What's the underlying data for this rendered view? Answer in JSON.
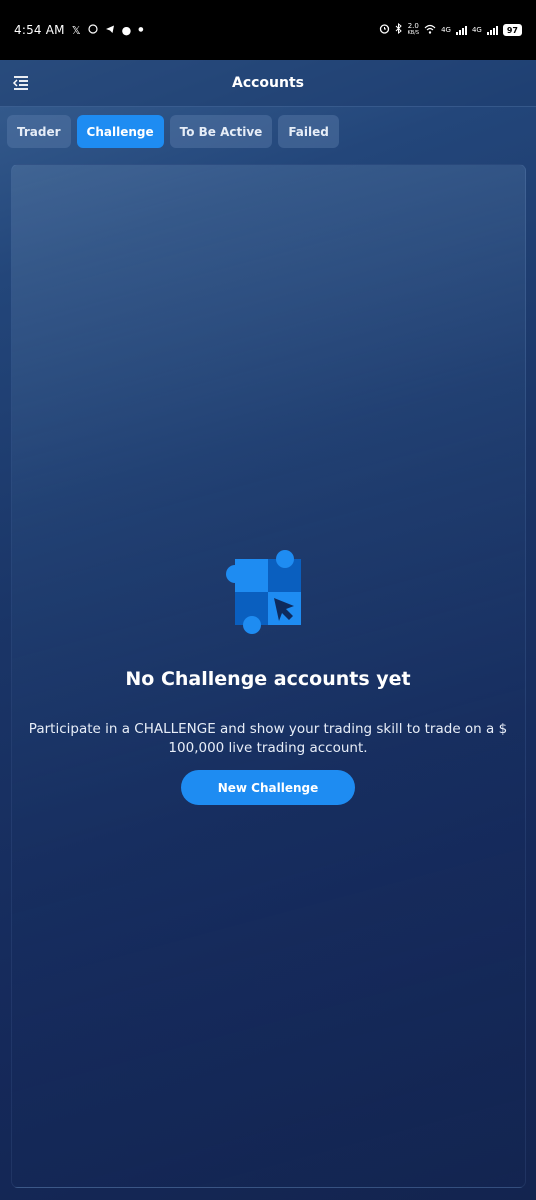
{
  "status_bar": {
    "time": "4:54 AM",
    "notification_icons": [
      "x-icon",
      "whatsapp-icon",
      "telegram-icon",
      "dot-icon",
      "dot-icon"
    ],
    "net_speed": "2.0",
    "net_speed_unit": "KB/S",
    "network1": "4G",
    "network2": "4G",
    "battery": "97"
  },
  "app_bar": {
    "title": "Accounts",
    "menu_icon": "menu-icon"
  },
  "tabs": [
    {
      "label": "Trader",
      "active": false
    },
    {
      "label": "Challenge",
      "active": true
    },
    {
      "label": "To Be Active",
      "active": false
    },
    {
      "label": "Failed",
      "active": false
    }
  ],
  "empty_state": {
    "icon": "puzzle-cursor-icon",
    "title": "No Challenge accounts yet",
    "description": "Participate in a CHALLENGE and show your trading skill to trade on a $ 100,000 live trading account.",
    "button_label": "New Challenge"
  },
  "colors": {
    "accent": "#1e8cf2",
    "background_top": "#3d6596",
    "background_bottom": "#13244f",
    "tab_inactive": "#4f6f97"
  }
}
